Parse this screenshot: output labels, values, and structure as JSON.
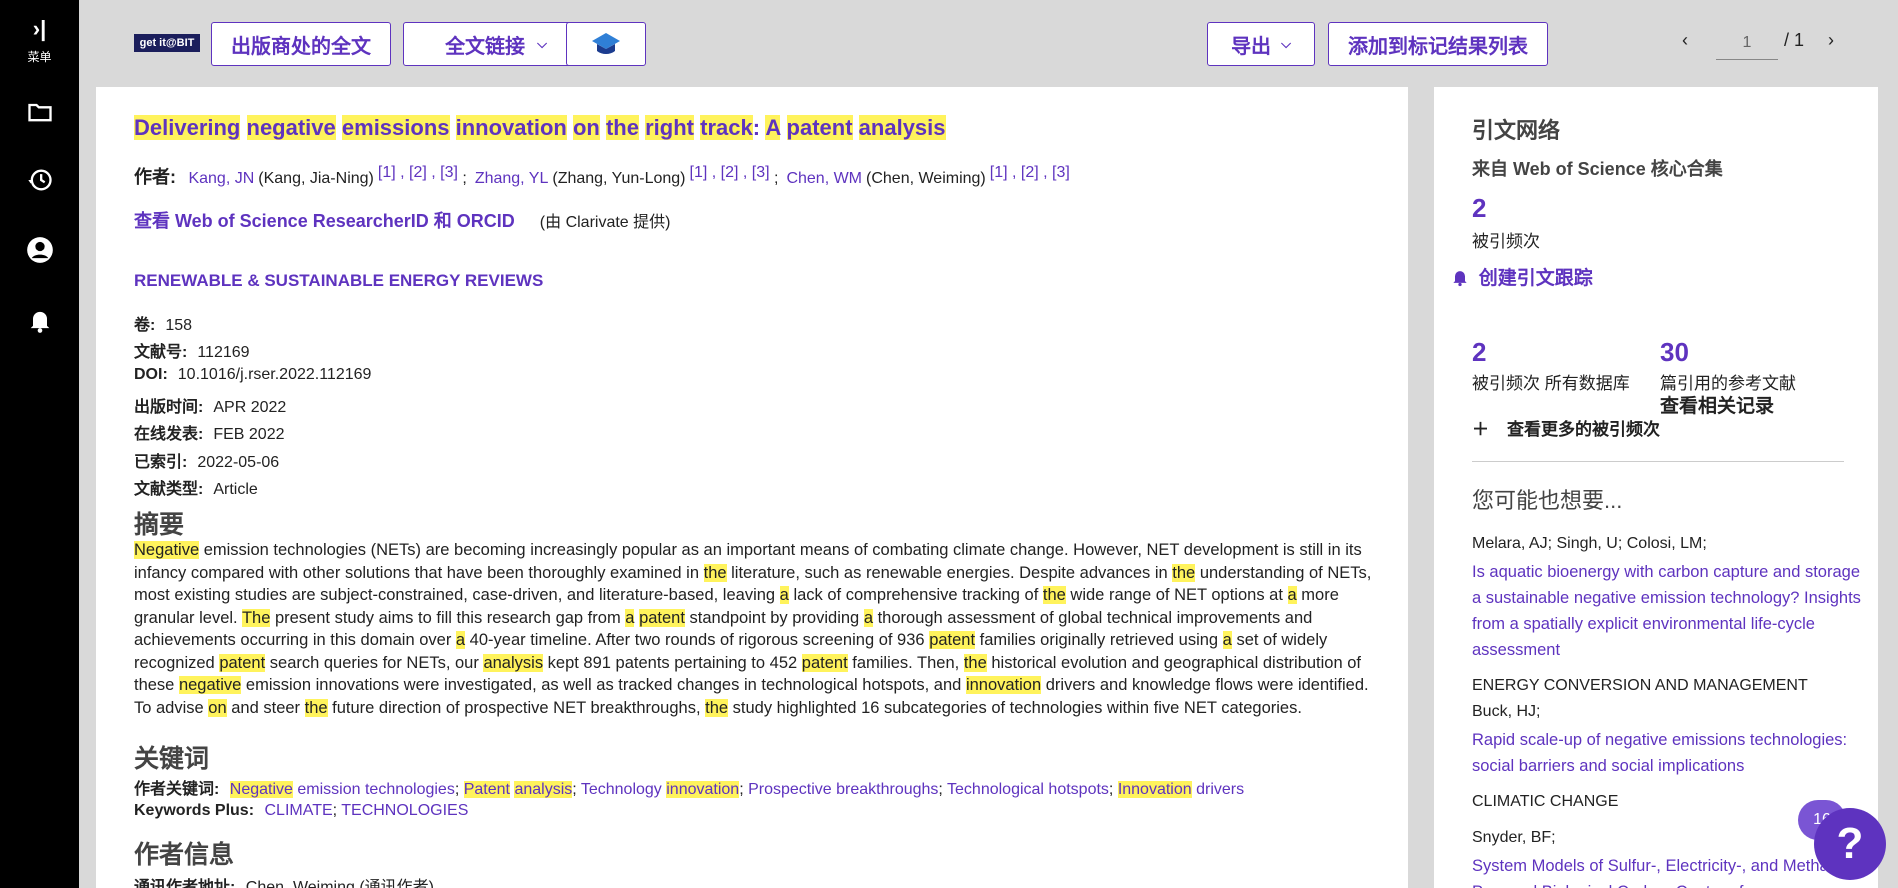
{
  "sidebar": {
    "menu_label": "菜单",
    "icons": [
      "folder-icon",
      "history-icon",
      "user-icon",
      "bell-icon"
    ]
  },
  "toolbar": {
    "getit_label": "get it@BIT",
    "publisher_fulltext": "出版商处的全文",
    "fulltext_links": "全文链接",
    "export": "导出",
    "add_marked": "添加到标记结果列表",
    "page_current": "1",
    "page_total": "/ 1"
  },
  "record": {
    "title_parts": [
      "Delivering",
      " ",
      "negative",
      " ",
      "emissions",
      " ",
      "innovation",
      " ",
      "on",
      " ",
      "the",
      " ",
      "right",
      " ",
      "track",
      ": ",
      "A",
      " ",
      "patent",
      " ",
      "analysis"
    ],
    "authors_label": "作者:",
    "authors": [
      {
        "short": "Kang, JN",
        "full": "(Kang, Jia-Ning)",
        "refs": "[1] , [2] , [3]"
      },
      {
        "short": "Zhang, YL",
        "full": "(Zhang, Yun-Long)",
        "refs": "[1] , [2] , [3]"
      },
      {
        "short": "Chen, WM",
        "full": "(Chen, Weiming)",
        "refs": "[1] , [2] , [3]"
      }
    ],
    "researcher_link": "查看 Web of Science ResearcherID 和 ORCID",
    "researcher_note": "(由 Clarivate 提供)",
    "journal": "RENEWABLE & SUSTAINABLE ENERGY REVIEWS",
    "meta": [
      {
        "label": "卷:",
        "value": "158"
      },
      {
        "label": "文献号:",
        "value": "112169"
      },
      {
        "label": "DOI:",
        "value": "10.1016/j.rser.2022.112169"
      },
      {
        "label": "出版时间:",
        "value": "APR 2022"
      },
      {
        "label": "在线发表:",
        "value": "FEB 2022"
      },
      {
        "label": "已索引:",
        "value": "2022-05-06"
      },
      {
        "label": "文献类型:",
        "value": "Article"
      }
    ],
    "abstract_heading": "摘要",
    "abstract_lines": [
      [
        [
          "Negative",
          true
        ],
        [
          " emission technologies (NETs) are becoming increasingly popular as an important means of combating climate change. However, NET development is still in its",
          false
        ]
      ],
      [
        [
          "infancy compared with other solutions that have been thoroughly examined in ",
          false
        ],
        [
          "the",
          true
        ],
        [
          " literature, such as renewable energies. Despite advances in ",
          false
        ],
        [
          "the",
          true
        ],
        [
          " understanding of NETs,",
          false
        ]
      ],
      [
        [
          "most existing studies are subject-constrained, case-driven, and literature-based, leaving ",
          false
        ],
        [
          "a",
          true
        ],
        [
          " lack of comprehensive tracking of ",
          false
        ],
        [
          "the",
          true
        ],
        [
          " wide range of NET options at ",
          false
        ],
        [
          "a",
          true
        ],
        [
          " more",
          false
        ]
      ],
      [
        [
          "granular level. ",
          false
        ],
        [
          "The",
          true
        ],
        [
          " present study aims to fill this research gap from ",
          false
        ],
        [
          "a",
          true
        ],
        [
          " ",
          false
        ],
        [
          "patent",
          true
        ],
        [
          " standpoint by providing ",
          false
        ],
        [
          "a",
          true
        ],
        [
          " thorough assessment of global technical improvements and",
          false
        ]
      ],
      [
        [
          "achievements occurring in this domain over ",
          false
        ],
        [
          "a",
          true
        ],
        [
          " 40-year timeline. After two rounds of rigorous screening of 936 ",
          false
        ],
        [
          "patent",
          true
        ],
        [
          " families originally retrieved using ",
          false
        ],
        [
          "a",
          true
        ],
        [
          " set of widely",
          false
        ]
      ],
      [
        [
          "recognized ",
          false
        ],
        [
          "patent",
          true
        ],
        [
          " search queries for NETs, our ",
          false
        ],
        [
          "analysis",
          true
        ],
        [
          " kept 891 patents pertaining to 452 ",
          false
        ],
        [
          "patent",
          true
        ],
        [
          " families. Then, ",
          false
        ],
        [
          "the",
          true
        ],
        [
          " historical evolution and geographical distribution of",
          false
        ]
      ],
      [
        [
          "these ",
          false
        ],
        [
          "negative",
          true
        ],
        [
          " emission innovations were investigated, as well as tracked changes in technological hotspots, and ",
          false
        ],
        [
          "innovation",
          true
        ],
        [
          " drivers and knowledge flows were identified.",
          false
        ]
      ],
      [
        [
          "To advise ",
          false
        ],
        [
          "on",
          true
        ],
        [
          " and steer ",
          false
        ],
        [
          "the",
          true
        ],
        [
          " future direction of prospective NET breakthroughs, ",
          false
        ],
        [
          "the",
          true
        ],
        [
          " study highlighted 16 subcategories of technologies within five NET categories.",
          false
        ]
      ]
    ],
    "keywords_heading": "关键词",
    "author_keywords_label": "作者关键词:",
    "author_keywords": [
      [
        [
          "Negative",
          true
        ],
        [
          " emission technologies",
          false
        ]
      ],
      [
        [
          "Patent",
          true
        ],
        [
          " ",
          false
        ],
        [
          "analysis",
          true
        ]
      ],
      [
        [
          "Technology ",
          false
        ],
        [
          "innovation",
          true
        ]
      ],
      [
        [
          "Prospective breakthroughs",
          false
        ]
      ],
      [
        [
          "Technological hotspots",
          false
        ]
      ],
      [
        [
          "Innovation",
          true
        ],
        [
          " drivers",
          false
        ]
      ]
    ],
    "keywords_plus_label": "Keywords Plus:",
    "keywords_plus": [
      "CLIMATE",
      "TECHNOLOGIES"
    ],
    "author_info_heading": "作者信息",
    "corresponding_label": "通讯作者地址:",
    "corresponding_value": "Chen, Weiming (通讯作者)"
  },
  "citation": {
    "heading": "引文网络",
    "source": "来自 Web of Science 核心合集",
    "times_cited": "2",
    "times_cited_label": "被引频次",
    "create_alert": "创建引文跟踪",
    "all_db_count": "2",
    "all_db_label": "被引频次 所有数据库",
    "refs_count": "30",
    "refs_label": "篇引用的参考文献",
    "related_link": "查看相关记录",
    "more_cited": "查看更多的被引频次",
    "suggest_heading": "您可能也想要...",
    "suggestions": [
      {
        "authors": "Melara, AJ; Singh, U; Colosi, LM;",
        "title": "Is aquatic bioenergy with carbon capture and storage a sustainable negative emission technology? Insights from a spatially explicit environmental life-cycle assessment",
        "source": "ENERGY CONVERSION AND MANAGEMENT"
      },
      {
        "authors": "Buck, HJ;",
        "title": "Rapid scale-up of negative emissions technologies: social barriers and social implications",
        "source": "CLIMATIC CHANGE"
      },
      {
        "authors": "Snyder, BF;",
        "title": "System Models of Sulfur-, Electricity-, and Methane-Powered Biological Carbon Capture for",
        "source": ""
      }
    ]
  },
  "help": {
    "badge": "16",
    "icon": "?"
  },
  "colors": {
    "accent": "#5e33bf",
    "highlight": "#fff35c",
    "sidebar": "#000000",
    "background": "#d9d9d9"
  }
}
